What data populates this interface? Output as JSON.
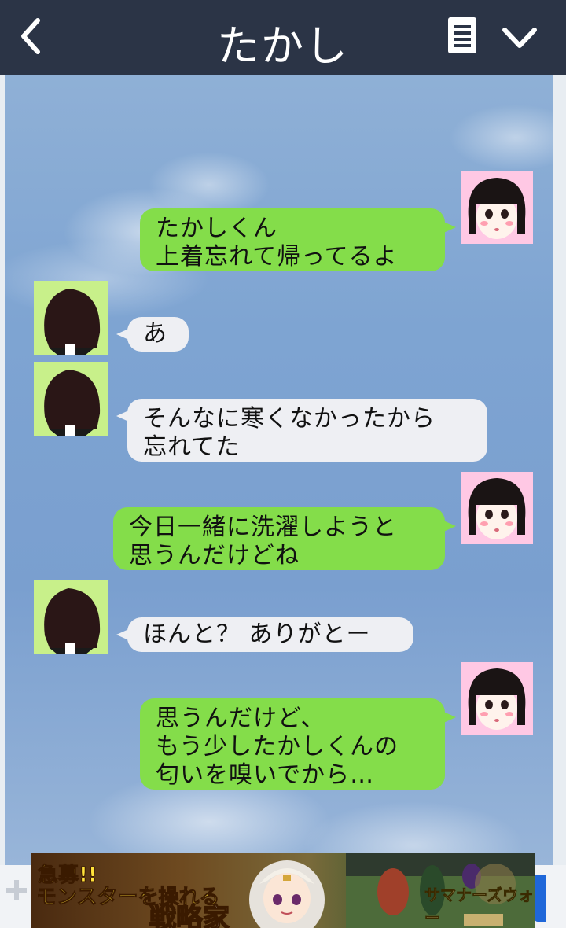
{
  "header": {
    "title": "たかし",
    "back_icon": "chevron-left-icon",
    "menu_icon": "document-icon",
    "expand_icon": "chevron-down-icon"
  },
  "messages": [
    {
      "from": "me",
      "text": "たかしくん\n上着忘れて帰ってるよ"
    },
    {
      "from": "takashi",
      "text": "あ"
    },
    {
      "from": "takashi",
      "text": "そんなに寒くなかったから\n忘れてた"
    },
    {
      "from": "me",
      "text": "今日一緒に洗濯しようと\n思うんだけどね"
    },
    {
      "from": "takashi",
      "text": "ほんと？ ありがとー"
    },
    {
      "from": "me",
      "text": "思うんだけど、\nもう少したかしくんの\n匂いを嗅いでから…"
    }
  ],
  "ad": {
    "line1": "急募!!",
    "line2": "モンスターを操れる",
    "line3": "戦略家",
    "logo": "サマナーズウォー"
  },
  "colors": {
    "header_bg": "#2b3446",
    "my_bubble": "#84dd4a",
    "their_bubble": "#eeeff3",
    "girl_avatar_bg": "#ffc8e4",
    "boy_avatar_bg": "#c8f08a"
  }
}
